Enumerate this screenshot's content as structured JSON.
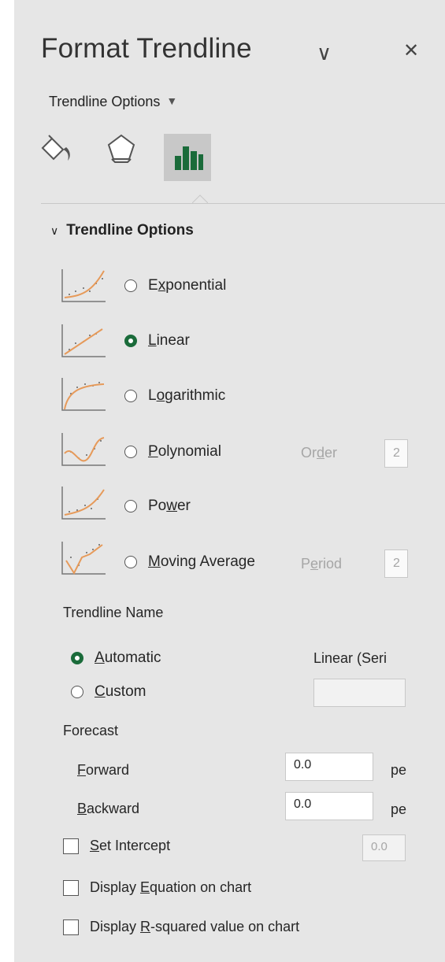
{
  "header": {
    "title": "Format Trendline",
    "collapse_glyph": "∨",
    "close_glyph": "✕",
    "options_dropdown": "Trendline Options",
    "dropdown_arrow": "▼"
  },
  "tabs": [
    {
      "icon": "fill-line-icon",
      "active": false
    },
    {
      "icon": "effects-pentagon-icon",
      "active": false
    },
    {
      "icon": "trendline-options-bar-icon",
      "active": true
    }
  ],
  "colors": {
    "accent_green": "#1a6b3a",
    "trend_orange": "#e69a5a"
  },
  "section": {
    "title": "Trendline Options",
    "chevron": "∨"
  },
  "types": [
    {
      "label_pre": "E",
      "label_u": "x",
      "label_post": "ponential",
      "selected": false,
      "icon": "exponential-trend-icon"
    },
    {
      "label_pre": "",
      "label_u": "L",
      "label_post": "inear",
      "selected": true,
      "icon": "linear-trend-icon"
    },
    {
      "label_pre": "L",
      "label_u": "o",
      "label_post": "garithmic",
      "selected": false,
      "icon": "logarithmic-trend-icon"
    },
    {
      "label_pre": "",
      "label_u": "P",
      "label_post": "olynomial",
      "selected": false,
      "icon": "polynomial-trend-icon"
    },
    {
      "label_pre": "Po",
      "label_u": "w",
      "label_post": "er",
      "selected": false,
      "icon": "power-trend-icon"
    },
    {
      "label_pre": "",
      "label_u": "M",
      "label_post": "oving Average",
      "selected": false,
      "icon": "moving-average-trend-icon"
    }
  ],
  "order": {
    "label_pre": "Or",
    "label_u": "d",
    "label_post": "er",
    "value": "2"
  },
  "period": {
    "label_pre": "P",
    "label_u": "e",
    "label_post": "riod",
    "value": "2"
  },
  "name": {
    "heading": "Trendline Name",
    "automatic_u": "A",
    "automatic_post": "utomatic",
    "automatic_value": "Linear (Seri",
    "custom_u": "C",
    "custom_post": "ustom",
    "custom_value": ""
  },
  "forecast": {
    "heading": "Forecast",
    "forward_u": "F",
    "forward_post": "orward",
    "forward_value": "0.0",
    "forward_unit": "pe",
    "backward_u": "B",
    "backward_post": "ackward",
    "backward_value": "0.0",
    "backward_unit": "pe"
  },
  "intercept": {
    "label_u": "S",
    "label_post": "et Intercept",
    "value": "0.0",
    "checked": false
  },
  "equation": {
    "label_pre": "Display ",
    "label_u": "E",
    "label_post": "quation on chart",
    "checked": false
  },
  "rsquared": {
    "label_pre": "Display ",
    "label_u": "R",
    "label_post": "-squared value on chart",
    "checked": false
  }
}
